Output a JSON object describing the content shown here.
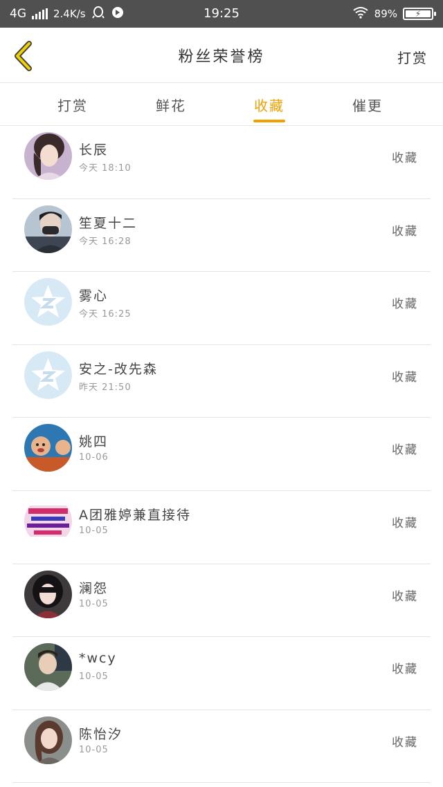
{
  "status_bar": {
    "network": "4G",
    "speed": "2.4K/s",
    "time": "19:25",
    "battery": "89%",
    "battery_level": 0.89
  },
  "header": {
    "title": "粉丝荣誉榜",
    "action_label": "打赏"
  },
  "tabs": [
    {
      "label": "打赏",
      "active": false
    },
    {
      "label": "鲜花",
      "active": false
    },
    {
      "label": "收藏",
      "active": true
    },
    {
      "label": "催更",
      "active": false
    }
  ],
  "accent_color": "#f2a000",
  "fans": [
    {
      "name": "长辰",
      "time": "今天 18:10",
      "action": "收藏",
      "avatar": "girl-photo"
    },
    {
      "name": "笙夏十二",
      "time": "今天 16:28",
      "action": "收藏",
      "avatar": "masked-boy-photo"
    },
    {
      "name": "雾心",
      "time": "今天 16:25",
      "action": "收藏",
      "avatar": "default-qzone-star"
    },
    {
      "name": "安之-改先森",
      "time": "昨天 21:50",
      "action": "收藏",
      "avatar": "default-qzone-star"
    },
    {
      "name": "姚四",
      "time": "10-06",
      "action": "收藏",
      "avatar": "cartoon-photo"
    },
    {
      "name": "A团雅婷兼直接待",
      "time": "10-05",
      "action": "收藏",
      "avatar": "ad-banner-photo"
    },
    {
      "name": "澜怨",
      "time": "10-05",
      "action": "收藏",
      "avatar": "dark-hair-girl-photo"
    },
    {
      "name": "*wcy",
      "time": "10-05",
      "action": "收藏",
      "avatar": "boy-photo"
    },
    {
      "name": "陈怡汐",
      "time": "10-05",
      "action": "收藏",
      "avatar": "long-hair-girl-photo"
    }
  ]
}
